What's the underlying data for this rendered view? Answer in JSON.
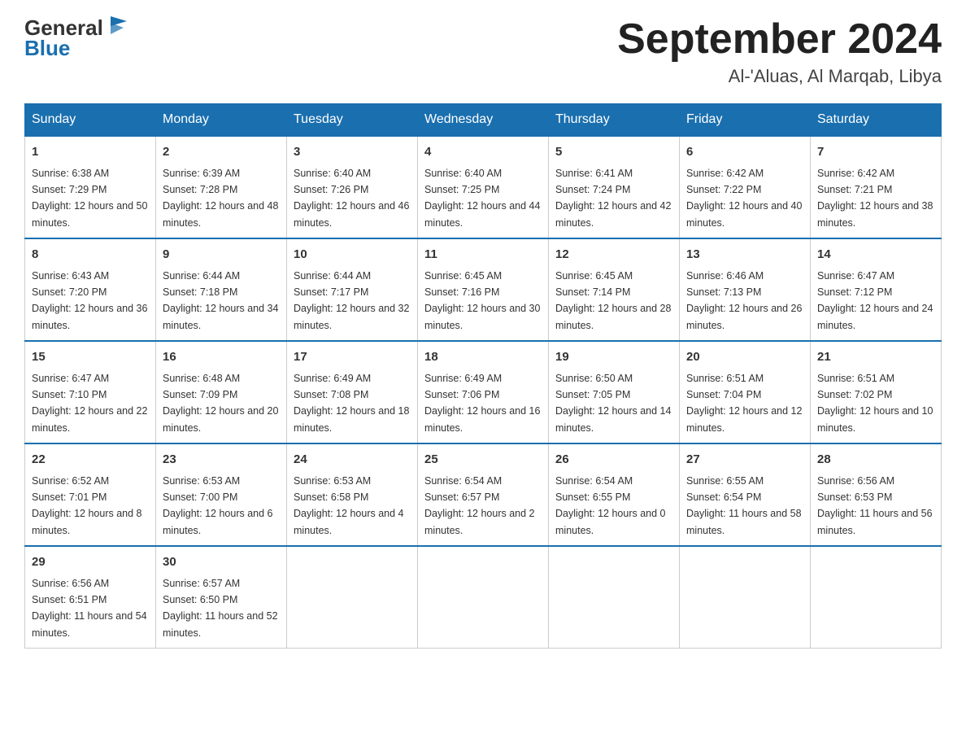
{
  "logo": {
    "text_general": "General",
    "text_blue": "Blue"
  },
  "title": "September 2024",
  "subtitle": "Al-'Aluas, Al Marqab, Libya",
  "days_of_week": [
    "Sunday",
    "Monday",
    "Tuesday",
    "Wednesday",
    "Thursday",
    "Friday",
    "Saturday"
  ],
  "weeks": [
    [
      {
        "day": "1",
        "sunrise": "6:38 AM",
        "sunset": "7:29 PM",
        "daylight": "12 hours and 50 minutes."
      },
      {
        "day": "2",
        "sunrise": "6:39 AM",
        "sunset": "7:28 PM",
        "daylight": "12 hours and 48 minutes."
      },
      {
        "day": "3",
        "sunrise": "6:40 AM",
        "sunset": "7:26 PM",
        "daylight": "12 hours and 46 minutes."
      },
      {
        "day": "4",
        "sunrise": "6:40 AM",
        "sunset": "7:25 PM",
        "daylight": "12 hours and 44 minutes."
      },
      {
        "day": "5",
        "sunrise": "6:41 AM",
        "sunset": "7:24 PM",
        "daylight": "12 hours and 42 minutes."
      },
      {
        "day": "6",
        "sunrise": "6:42 AM",
        "sunset": "7:22 PM",
        "daylight": "12 hours and 40 minutes."
      },
      {
        "day": "7",
        "sunrise": "6:42 AM",
        "sunset": "7:21 PM",
        "daylight": "12 hours and 38 minutes."
      }
    ],
    [
      {
        "day": "8",
        "sunrise": "6:43 AM",
        "sunset": "7:20 PM",
        "daylight": "12 hours and 36 minutes."
      },
      {
        "day": "9",
        "sunrise": "6:44 AM",
        "sunset": "7:18 PM",
        "daylight": "12 hours and 34 minutes."
      },
      {
        "day": "10",
        "sunrise": "6:44 AM",
        "sunset": "7:17 PM",
        "daylight": "12 hours and 32 minutes."
      },
      {
        "day": "11",
        "sunrise": "6:45 AM",
        "sunset": "7:16 PM",
        "daylight": "12 hours and 30 minutes."
      },
      {
        "day": "12",
        "sunrise": "6:45 AM",
        "sunset": "7:14 PM",
        "daylight": "12 hours and 28 minutes."
      },
      {
        "day": "13",
        "sunrise": "6:46 AM",
        "sunset": "7:13 PM",
        "daylight": "12 hours and 26 minutes."
      },
      {
        "day": "14",
        "sunrise": "6:47 AM",
        "sunset": "7:12 PM",
        "daylight": "12 hours and 24 minutes."
      }
    ],
    [
      {
        "day": "15",
        "sunrise": "6:47 AM",
        "sunset": "7:10 PM",
        "daylight": "12 hours and 22 minutes."
      },
      {
        "day": "16",
        "sunrise": "6:48 AM",
        "sunset": "7:09 PM",
        "daylight": "12 hours and 20 minutes."
      },
      {
        "day": "17",
        "sunrise": "6:49 AM",
        "sunset": "7:08 PM",
        "daylight": "12 hours and 18 minutes."
      },
      {
        "day": "18",
        "sunrise": "6:49 AM",
        "sunset": "7:06 PM",
        "daylight": "12 hours and 16 minutes."
      },
      {
        "day": "19",
        "sunrise": "6:50 AM",
        "sunset": "7:05 PM",
        "daylight": "12 hours and 14 minutes."
      },
      {
        "day": "20",
        "sunrise": "6:51 AM",
        "sunset": "7:04 PM",
        "daylight": "12 hours and 12 minutes."
      },
      {
        "day": "21",
        "sunrise": "6:51 AM",
        "sunset": "7:02 PM",
        "daylight": "12 hours and 10 minutes."
      }
    ],
    [
      {
        "day": "22",
        "sunrise": "6:52 AM",
        "sunset": "7:01 PM",
        "daylight": "12 hours and 8 minutes."
      },
      {
        "day": "23",
        "sunrise": "6:53 AM",
        "sunset": "7:00 PM",
        "daylight": "12 hours and 6 minutes."
      },
      {
        "day": "24",
        "sunrise": "6:53 AM",
        "sunset": "6:58 PM",
        "daylight": "12 hours and 4 minutes."
      },
      {
        "day": "25",
        "sunrise": "6:54 AM",
        "sunset": "6:57 PM",
        "daylight": "12 hours and 2 minutes."
      },
      {
        "day": "26",
        "sunrise": "6:54 AM",
        "sunset": "6:55 PM",
        "daylight": "12 hours and 0 minutes."
      },
      {
        "day": "27",
        "sunrise": "6:55 AM",
        "sunset": "6:54 PM",
        "daylight": "11 hours and 58 minutes."
      },
      {
        "day": "28",
        "sunrise": "6:56 AM",
        "sunset": "6:53 PM",
        "daylight": "11 hours and 56 minutes."
      }
    ],
    [
      {
        "day": "29",
        "sunrise": "6:56 AM",
        "sunset": "6:51 PM",
        "daylight": "11 hours and 54 minutes."
      },
      {
        "day": "30",
        "sunrise": "6:57 AM",
        "sunset": "6:50 PM",
        "daylight": "11 hours and 52 minutes."
      },
      null,
      null,
      null,
      null,
      null
    ]
  ]
}
